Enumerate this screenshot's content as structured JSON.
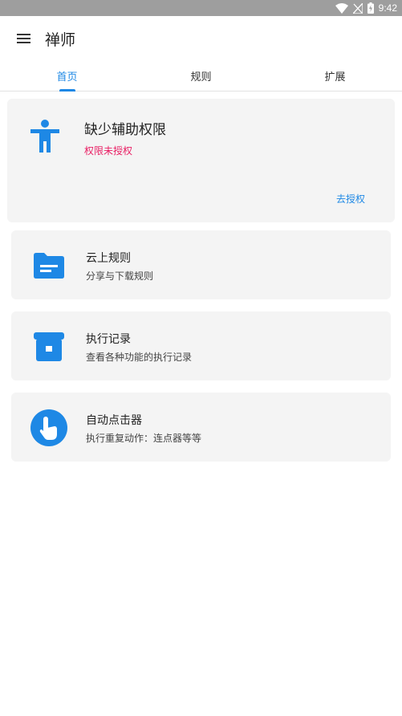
{
  "status_bar": {
    "time": "9:42"
  },
  "app_bar": {
    "title": "禅师"
  },
  "tabs": [
    {
      "label": "首页"
    },
    {
      "label": "规则"
    },
    {
      "label": "扩展"
    }
  ],
  "permission_card": {
    "title": "缺少辅助权限",
    "subtitle": "权限未授权",
    "action": "去授权"
  },
  "items": [
    {
      "title": "云上规则",
      "subtitle": "分享与下载规则",
      "icon": "folder-icon"
    },
    {
      "title": "执行记录",
      "subtitle": "查看各种功能的执行记录",
      "icon": "archive-icon"
    },
    {
      "title": "自动点击器",
      "subtitle": "执行重复动作：连点器等等",
      "icon": "touch-icon"
    }
  ],
  "colors": {
    "accent": "#1e88e5",
    "warning": "#e91e63",
    "card_bg": "#f4f4f4",
    "status_bar": "#9e9e9e"
  }
}
